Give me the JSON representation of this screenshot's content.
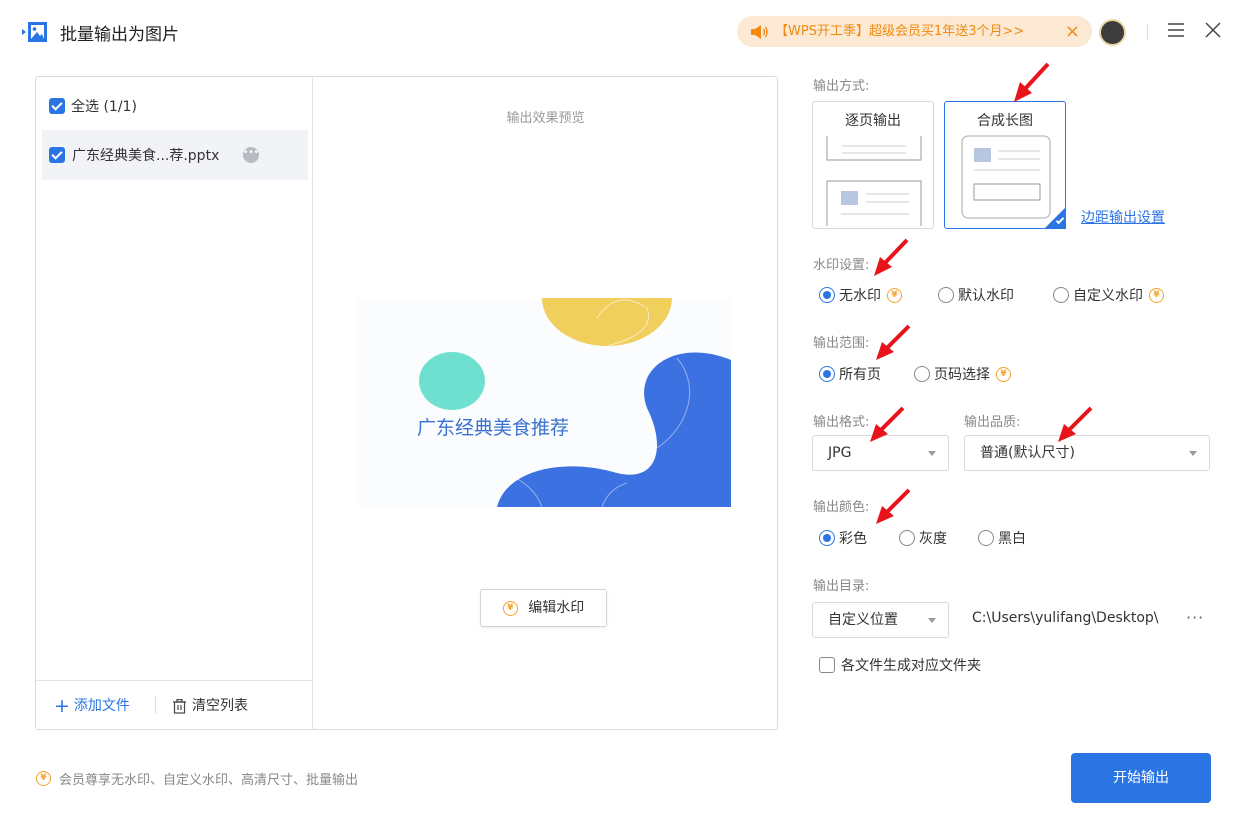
{
  "window": {
    "title": "批量输出为图片",
    "promo_text": "【WPS开工季】超级会员买1年送3个月>>",
    "promo_close": "×"
  },
  "file_list": {
    "select_all_label": "全选 (1/1)",
    "files": [
      {
        "name": "广东经典美食...荐.pptx",
        "checked": true
      }
    ],
    "add_file_label": "添加文件",
    "clear_list_label": "清空列表"
  },
  "preview": {
    "label": "输出效果预览",
    "slide_title": "广东经典美食推荐",
    "edit_watermark_label": "编辑水印"
  },
  "settings": {
    "output_mode": {
      "label": "输出方式:",
      "options": [
        "逐页输出",
        "合成长图"
      ],
      "selected": "合成长图",
      "margin_link": "边距输出设置"
    },
    "watermark": {
      "label": "水印设置:",
      "options": [
        "无水印",
        "默认水印",
        "自定义水印"
      ],
      "selected": "无水印"
    },
    "range": {
      "label": "输出范围:",
      "options": [
        "所有页",
        "页码选择"
      ],
      "selected": "所有页"
    },
    "format": {
      "label": "输出格式:",
      "value": "JPG"
    },
    "quality": {
      "label": "输出品质:",
      "value": "普通(默认尺寸)"
    },
    "color": {
      "label": "输出颜色:",
      "options": [
        "彩色",
        "灰度",
        "黑白"
      ],
      "selected": "彩色"
    },
    "directory": {
      "label": "输出目录:",
      "location_value": "自定义位置",
      "path": "C:\\Users\\yulifang\\Desktop\\",
      "more": "···",
      "per_file_folder_label": "各文件生成对应文件夹",
      "per_file_folder_checked": false
    }
  },
  "footer": {
    "member_note": "会员尊享无水印、自定义水印、高清尺寸、批量输出",
    "start_button": "开始输出"
  },
  "colors": {
    "accent": "#2b74e4",
    "coin": "#f4a32a",
    "promo_bg": "#fbe9d3",
    "promo_text": "#f08a12",
    "annotation_arrow": "#e8131b"
  },
  "icons": {
    "coin": "¥"
  }
}
